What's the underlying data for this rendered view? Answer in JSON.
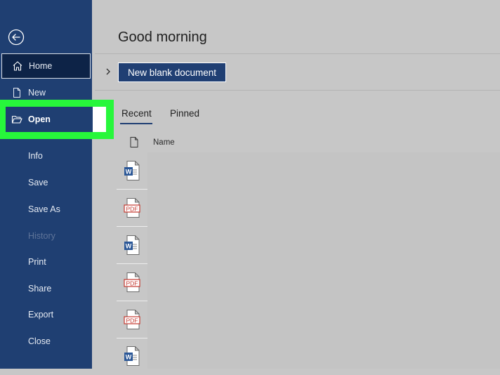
{
  "sidebar": {
    "items": [
      {
        "label": "Home",
        "icon": "home-icon"
      },
      {
        "label": "New",
        "icon": "new-document-icon"
      },
      {
        "label": "Open",
        "icon": "folder-open-icon"
      },
      {
        "label": "Info"
      },
      {
        "label": "Save"
      },
      {
        "label": "Save As"
      },
      {
        "label": "History"
      },
      {
        "label": "Print"
      },
      {
        "label": "Share"
      },
      {
        "label": "Export"
      },
      {
        "label": "Close"
      }
    ]
  },
  "main": {
    "greeting": "Good morning",
    "new_blank_label": "New blank document",
    "tabs": [
      {
        "label": "Recent"
      },
      {
        "label": "Pinned"
      }
    ],
    "list_header": {
      "name": "Name"
    },
    "files": [
      {
        "type": "word",
        "label": "W"
      },
      {
        "type": "pdf",
        "label": "PDF"
      },
      {
        "type": "word",
        "label": "W"
      },
      {
        "type": "pdf",
        "label": "PDF"
      },
      {
        "type": "pdf",
        "label": "PDF"
      },
      {
        "type": "word",
        "label": "W"
      }
    ]
  },
  "colors": {
    "sidebar": "#1f3f72",
    "highlight": "#27f73b",
    "accent": "#203f73",
    "pdf": "#c43a31"
  }
}
